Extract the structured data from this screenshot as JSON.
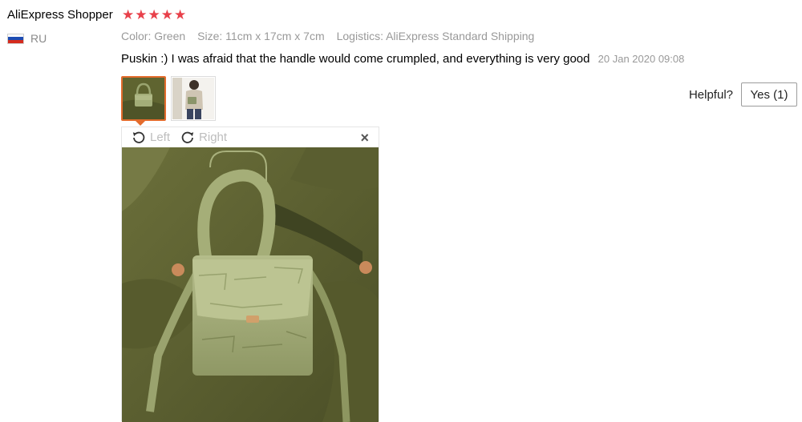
{
  "review": {
    "user_name": "AliExpress Shopper",
    "rating": 5,
    "country": "RU",
    "flag_colors": [
      "#ffffff",
      "#1d4cb3",
      "#d52b1e"
    ],
    "color_attr": "Color: Green",
    "size_attr": "Size: 11cm x 17cm x 7cm",
    "logistics_attr": "Logistics: AliExpress Standard Shipping",
    "text": "Puskin :) I was afraid that the handle would come crumpled, and everything is very good",
    "date": "20 Jan 2020 09:08"
  },
  "helpful": {
    "label": "Helpful?",
    "yes_label": "Yes (1)"
  },
  "viewer": {
    "rotate_left_label": "Left",
    "rotate_right_label": "Right",
    "close_symbol": "×"
  },
  "icons": {
    "star": "star-icon",
    "rotate_left": "rotate-left-icon",
    "rotate_right": "rotate-right-icon",
    "close": "close-icon"
  },
  "colors": {
    "star": "#e8404a",
    "active_thumb_border": "#e36b2c",
    "muted_text": "#999999"
  }
}
